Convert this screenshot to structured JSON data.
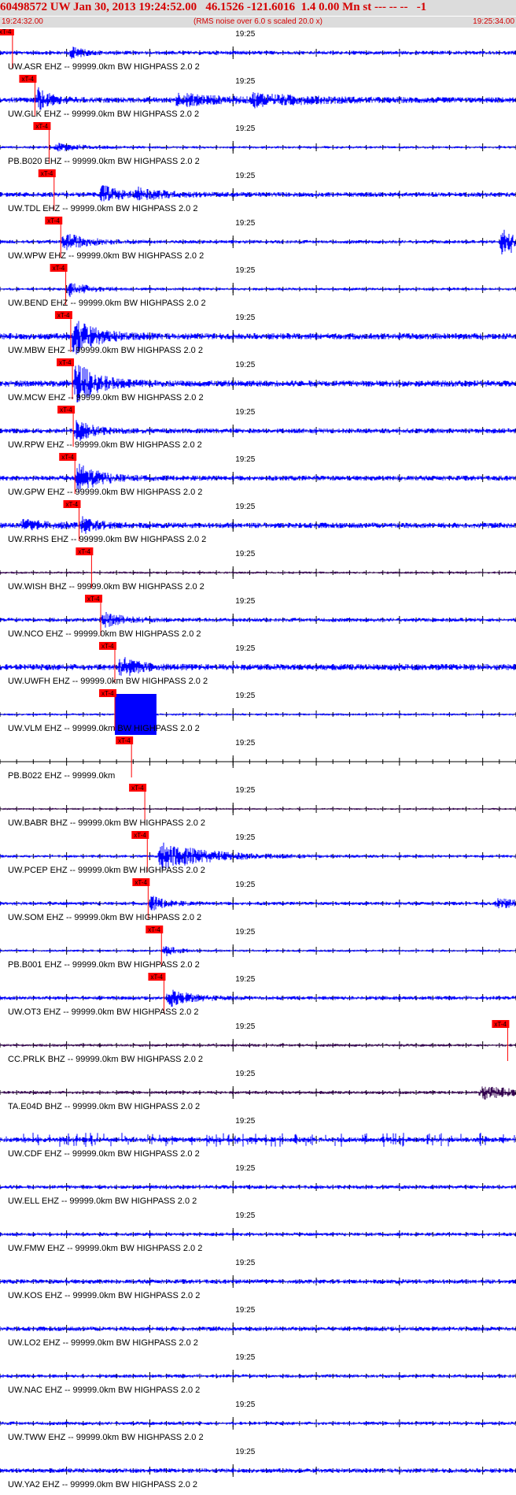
{
  "header": {
    "title": "60498572 UW Jan 30, 2013 19:24:52.00   46.1526 -121.6016  1.4 0.00 Mn st --- -- --   -1",
    "start_time": "19:24:32.00",
    "note": "(RMS noise over 6.0 s scaled 20.0 x)",
    "end_time": "19:25:34.00"
  },
  "colors": {
    "trace": "#0000ff",
    "trace_dark": "#33004f",
    "pick": "#ff0000",
    "text_red": "#d40000",
    "header_bg": "#dcdcdc"
  },
  "chart_data": {
    "type": "line",
    "title": "60498572 UW Jan 30, 2013 19:24:52.00   46.1526 -121.6016  1.4 0.00 Mn st --- -- --   -1",
    "xlabel": "",
    "ylabel": "",
    "x_start": "19:24:32.00",
    "x_end": "19:25:34.00",
    "xlim": [
      0,
      62
    ],
    "minute_mark": {
      "label": "19:25",
      "t": 28
    },
    "pick_label": "xT-4",
    "grid": false,
    "traces": [
      {
        "label": "UW.ASR EHZ -- 99999.0km BW  HIGHPASS  2.0  2",
        "pick_t": 1.5,
        "color": "trace",
        "noise": 2.5,
        "bursts": [
          [
            8.4,
            12,
            0.25
          ]
        ]
      },
      {
        "label": "UW.GLK EHZ -- 99999.0km BW  HIGHPASS  2.0  2",
        "pick_t": 4.2,
        "color": "trace",
        "noise": 3.5,
        "bursts": [
          [
            4.3,
            16,
            0.4
          ],
          [
            21,
            8,
            1.5
          ],
          [
            30,
            7,
            2
          ]
        ]
      },
      {
        "label": "PB.B020 EHZ -- 99999.0km BW  HIGHPASS  2.0  2",
        "pick_t": 5.9,
        "color": "trace",
        "noise": 1.6,
        "bursts": [
          [
            6.5,
            5,
            1
          ]
        ]
      },
      {
        "label": "UW.TDL EHZ -- 99999.0km BW  HIGHPASS  2.0  2",
        "pick_t": 6.5,
        "color": "trace",
        "noise": 3.0,
        "bursts": [
          [
            12,
            14,
            0.5
          ],
          [
            16,
            8,
            1
          ]
        ]
      },
      {
        "label": "UW.WPW EHZ -- 99999.0km BW  HIGHPASS  2.0  2",
        "pick_t": 7.3,
        "color": "trace",
        "noise": 2.2,
        "bursts": [
          [
            7.4,
            12,
            0.8
          ],
          [
            60,
            16,
            2
          ]
        ]
      },
      {
        "label": "UW.BEND EHZ -- 99999.0km BW  HIGHPASS  2.0  2",
        "pick_t": 7.9,
        "color": "trace",
        "noise": 1.8,
        "bursts": [
          [
            8,
            10,
            0.7
          ]
        ]
      },
      {
        "label": "UW.MBW EHZ -- 99999.0km BW  HIGHPASS  2.0  2",
        "pick_t": 8.5,
        "color": "trace",
        "noise": 4.0,
        "bursts": [
          [
            8.6,
            26,
            0.7
          ]
        ]
      },
      {
        "label": "UW.MCW EHZ -- 99999.0km BW  HIGHPASS  2.0  2",
        "pick_t": 8.7,
        "color": "trace",
        "noise": 4.0,
        "bursts": [
          [
            8.8,
            30,
            0.7
          ]
        ]
      },
      {
        "label": "UW.RPW EHZ -- 99999.0km BW  HIGHPASS  2.0  2",
        "pick_t": 8.8,
        "color": "trace",
        "noise": 3.2,
        "bursts": [
          [
            8.9,
            16,
            0.5
          ]
        ]
      },
      {
        "label": "UW.GPW EHZ -- 99999.0km BW  HIGHPASS  2.0  2",
        "pick_t": 9.0,
        "color": "trace",
        "noise": 3.2,
        "bursts": [
          [
            9.1,
            20,
            0.7
          ]
        ]
      },
      {
        "label": "UW.RRHS EHZ -- 99999.0km BW  HIGHPASS  2.0  2",
        "pick_t": 9.5,
        "color": "trace",
        "noise": 3.5,
        "bursts": [
          [
            9.6,
            10,
            0.5
          ],
          [
            2.5,
            6,
            1
          ]
        ]
      },
      {
        "label": "UW.WISH BHZ -- 99999.0km BW  HIGHPASS  2.0  2",
        "pick_t": 11.0,
        "color": "trace_dark",
        "noise": 1.5,
        "bursts": []
      },
      {
        "label": "UW.NCO EHZ -- 99999.0km BW  HIGHPASS  2.0  2",
        "pick_t": 12.1,
        "color": "trace",
        "noise": 2.5,
        "bursts": [
          [
            12.2,
            10,
            0.7
          ]
        ]
      },
      {
        "label": "UW.UWFH EHZ -- 99999.0km BW  HIGHPASS  2.0  2",
        "pick_t": 13.8,
        "color": "trace",
        "noise": 4.0,
        "bursts": [
          [
            14.2,
            16,
            0.5
          ]
        ]
      },
      {
        "label": "UW.VLM EHZ -- 99999.0km BW  HIGHPASS  2.0  2",
        "pick_t": 13.8,
        "color": "trace",
        "noise": 1.5,
        "bursts": [],
        "saturated": [
          13.8,
          18.8
        ]
      },
      {
        "label": "PB.B022 EHZ -- 99999.0km",
        "pick_t": 15.8,
        "color": "trace",
        "noise": 0,
        "bursts": []
      },
      {
        "label": "UW.BABR BHZ -- 99999.0km BW  HIGHPASS  2.0  2",
        "pick_t": 17.4,
        "color": "trace_dark",
        "noise": 1.2,
        "bursts": []
      },
      {
        "label": "UW.PCEP EHZ -- 99999.0km BW  HIGHPASS  2.0  2",
        "pick_t": 17.7,
        "color": "trace",
        "noise": 1.8,
        "bursts": [
          [
            19,
            18,
            1.8
          ]
        ]
      },
      {
        "label": "UW.SOM EHZ -- 99999.0km BW  HIGHPASS  2.0  2",
        "pick_t": 17.8,
        "color": "trace",
        "noise": 2.2,
        "bursts": [
          [
            17.9,
            10,
            0.5
          ],
          [
            59.5,
            6,
            1
          ]
        ]
      },
      {
        "label": "PB.B001 EHZ -- 99999.0km BW  HIGHPASS  2.0  2",
        "pick_t": 19.4,
        "color": "trace",
        "noise": 1.5,
        "bursts": [
          [
            19.5,
            8,
            0.4
          ]
        ]
      },
      {
        "label": "UW.OT3 EHZ -- 99999.0km BW  HIGHPASS  2.0  2",
        "pick_t": 19.7,
        "color": "trace",
        "noise": 2.5,
        "bursts": [
          [
            20,
            12,
            0.7
          ]
        ]
      },
      {
        "label": "CC.PRLK BHZ -- 99999.0km BW  HIGHPASS  2.0  2",
        "pick_t": 61.0,
        "color": "trace_dark",
        "noise": 1.8,
        "bursts": []
      },
      {
        "label": "TA.E04D BHZ -- 99999.0km BW  HIGHPASS  2.0  2",
        "pick_t": null,
        "color": "trace_dark",
        "noise": 2.0,
        "bursts": [
          [
            57.5,
            9,
            1.2
          ]
        ]
      },
      {
        "label": "UW.CDF EHZ -- 99999.0km BW  HIGHPASS  2.0  2",
        "pick_t": null,
        "color": "trace",
        "noise": 3.0,
        "bursts": [],
        "spiky": true
      },
      {
        "label": "UW.ELL EHZ -- 99999.0km BW  HIGHPASS  2.0  2",
        "pick_t": null,
        "color": "trace",
        "noise": 2.5,
        "bursts": []
      },
      {
        "label": "UW.FMW EHZ -- 99999.0km BW  HIGHPASS  2.0  2",
        "pick_t": null,
        "color": "trace",
        "noise": 2.2,
        "bursts": []
      },
      {
        "label": "UW.KOS EHZ -- 99999.0km BW  HIGHPASS  2.0  2",
        "pick_t": null,
        "color": "trace",
        "noise": 2.8,
        "bursts": []
      },
      {
        "label": "UW.LO2 EHZ -- 99999.0km BW  HIGHPASS  2.0  2",
        "pick_t": null,
        "color": "trace",
        "noise": 2.8,
        "bursts": []
      },
      {
        "label": "UW.NAC EHZ -- 99999.0km BW  HIGHPASS  2.0  2",
        "pick_t": null,
        "color": "trace",
        "noise": 2.2,
        "bursts": []
      },
      {
        "label": "UW.TWW EHZ -- 99999.0km BW  HIGHPASS  2.0  2",
        "pick_t": null,
        "color": "trace",
        "noise": 2.2,
        "bursts": []
      },
      {
        "label": "UW.YA2 EHZ -- 99999.0km BW  HIGHPASS  2.0  2",
        "pick_t": null,
        "color": "trace",
        "noise": 2.8,
        "bursts": []
      }
    ]
  }
}
